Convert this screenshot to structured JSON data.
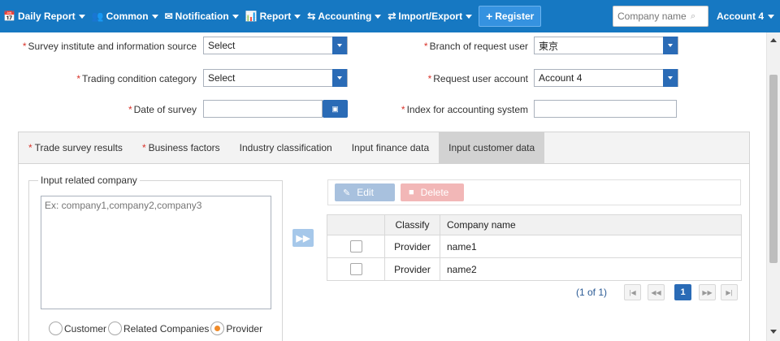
{
  "nav": {
    "items": [
      {
        "icon": "calendar-icon",
        "glyph": "📅",
        "label": "Daily Report"
      },
      {
        "icon": "users-icon",
        "glyph": "👥",
        "label": "Common"
      },
      {
        "icon": "envelope-icon",
        "glyph": "✉",
        "label": "Notification"
      },
      {
        "icon": "bar-chart-icon",
        "glyph": "📊",
        "label": "Report"
      },
      {
        "icon": "exchange-icon",
        "glyph": "⇆",
        "label": "Accounting"
      },
      {
        "icon": "transfer-icon",
        "glyph": "⇄",
        "label": "Import/Export"
      }
    ],
    "register_label": "Register",
    "search_placeholder": "Company name",
    "account_label": "Account 4"
  },
  "form": {
    "survey_source": {
      "label": "Survey institute and information source",
      "value": "Select"
    },
    "trading_category": {
      "label": "Trading condition category",
      "value": "Select"
    },
    "date_of_survey": {
      "label": "Date of survey",
      "value": ""
    },
    "branch": {
      "label": "Branch of request user",
      "value": "東京"
    },
    "request_account": {
      "label": "Request user account",
      "value": "Account 4"
    },
    "accounting_index": {
      "label": "Index for accounting system",
      "value": ""
    }
  },
  "tabs": [
    {
      "label": "Trade survey results",
      "required": true
    },
    {
      "label": "Business factors",
      "required": true
    },
    {
      "label": "Industry classification",
      "required": false
    },
    {
      "label": "Input finance data",
      "required": false
    },
    {
      "label": "Input customer data",
      "required": false,
      "active": true
    }
  ],
  "related": {
    "legend": "Input related company",
    "placeholder": "Ex: company1,company2,company3",
    "radios": [
      {
        "label": "Customer",
        "checked": false
      },
      {
        "label": "Related Companies",
        "checked": false
      },
      {
        "label": "Provider",
        "checked": true
      }
    ]
  },
  "toolbar": {
    "edit_label": "Edit",
    "delete_label": "Delete"
  },
  "table": {
    "headers": [
      "",
      "Classify",
      "Company name"
    ],
    "rows": [
      {
        "classify": "Provider",
        "company": "name1"
      },
      {
        "classify": "Provider",
        "company": "name2"
      }
    ]
  },
  "pager": {
    "summary": "(1 of 1)",
    "current_page": "1"
  }
}
